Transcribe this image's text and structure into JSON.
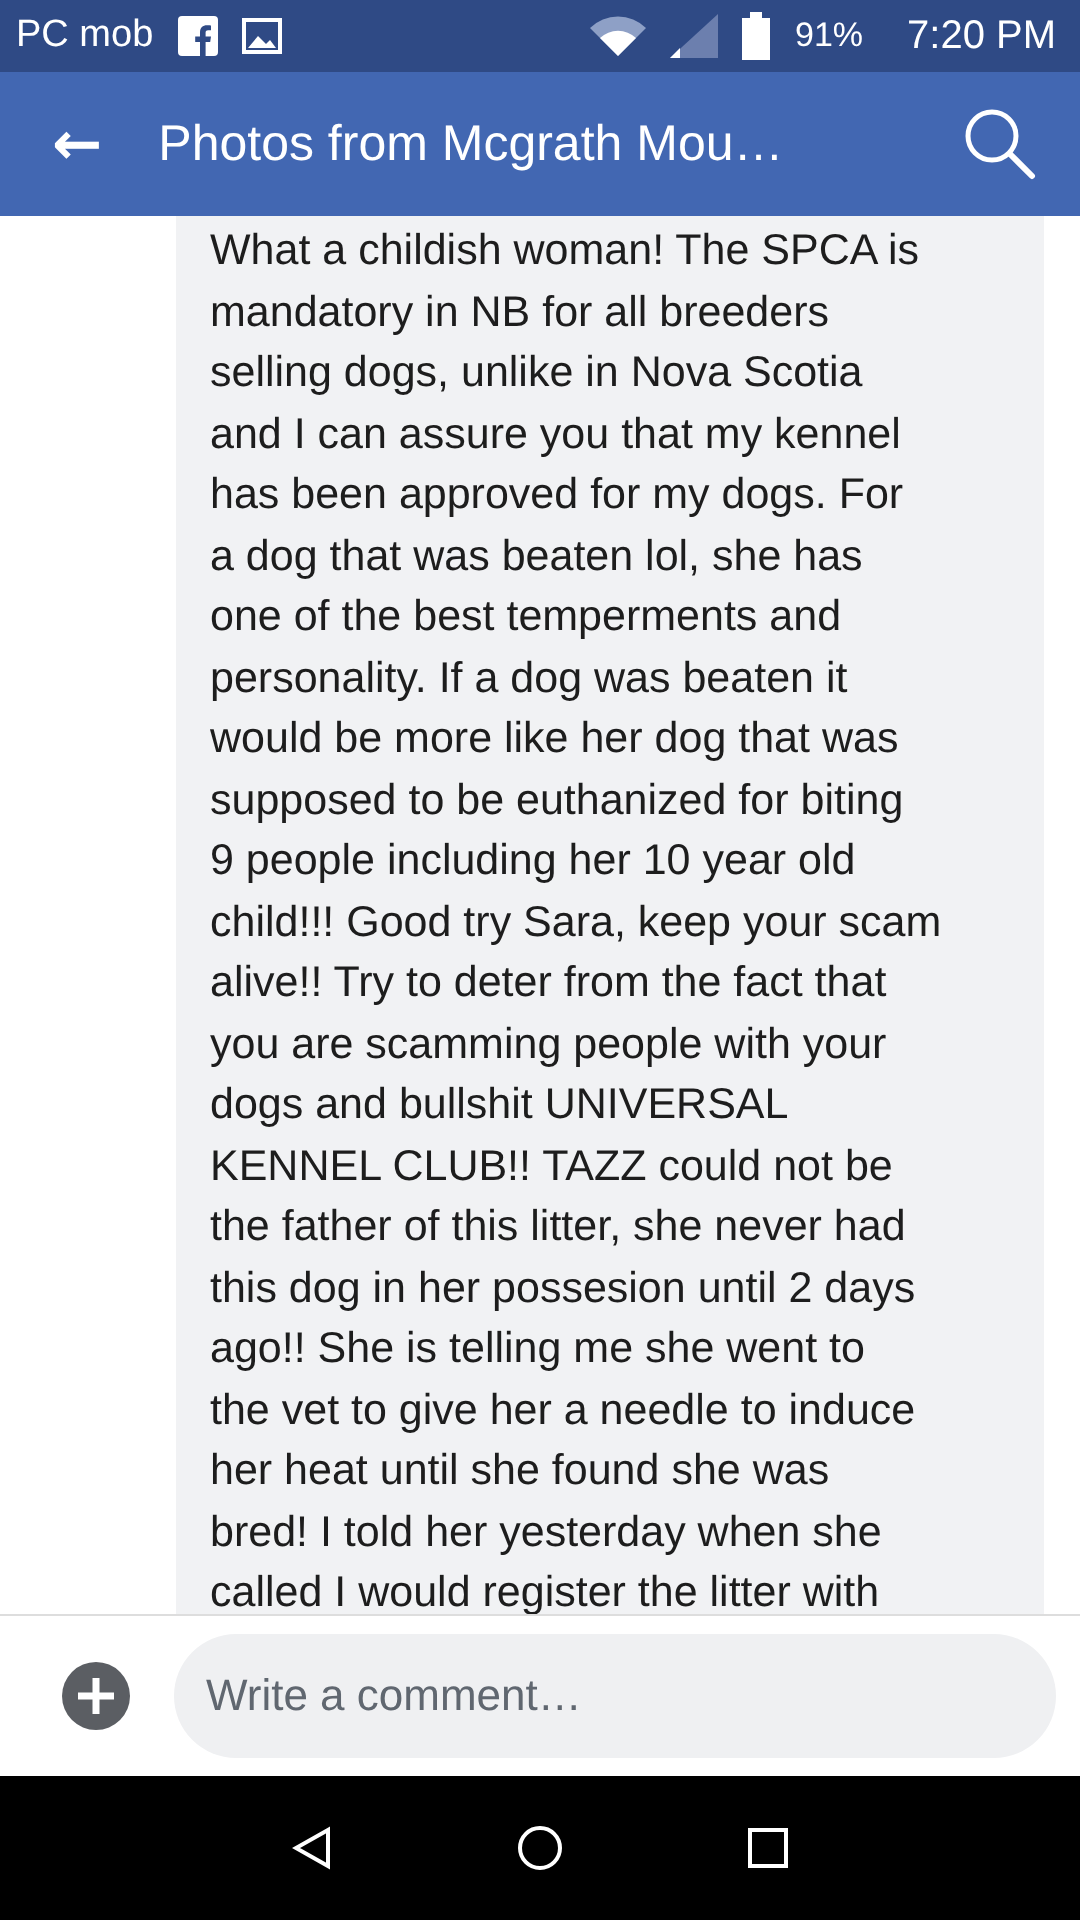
{
  "status_bar": {
    "carrier": "PC mob",
    "battery": "91%",
    "time": "7:20 PM"
  },
  "header": {
    "back": "←",
    "title": "Photos from Mcgrath Mou…"
  },
  "comment": {
    "lines": [
      "What a childish woman! The SPCA is",
      "mandatory in NB for all breeders",
      "selling dogs, unlike in Nova Scotia",
      "and I can assure you that my kennel",
      "has been approved for my dogs. For",
      "a dog that was beaten lol, she has",
      "one of the best temperments and",
      "personality. If a dog was beaten it",
      "would be more like her dog that was",
      "supposed to be euthanized for biting",
      "9 people including her 10 year old",
      "child!!! Good try Sara, keep your scam",
      "alive!! Try to deter from the fact that",
      "you are scamming people with your",
      "dogs and bullshit UNIVERSAL",
      "KENNEL CLUB!! TAZZ could not be",
      "the father of this litter, she never had",
      "this dog in her possesion until 2 days",
      "ago!! She is telling me she went to",
      "the vet to give her a needle to induce",
      "her heat until she found she was",
      "bred! I told her yesterday when she",
      "called I would register the litter with"
    ]
  },
  "composer": {
    "placeholder": "Write a comment…"
  }
}
